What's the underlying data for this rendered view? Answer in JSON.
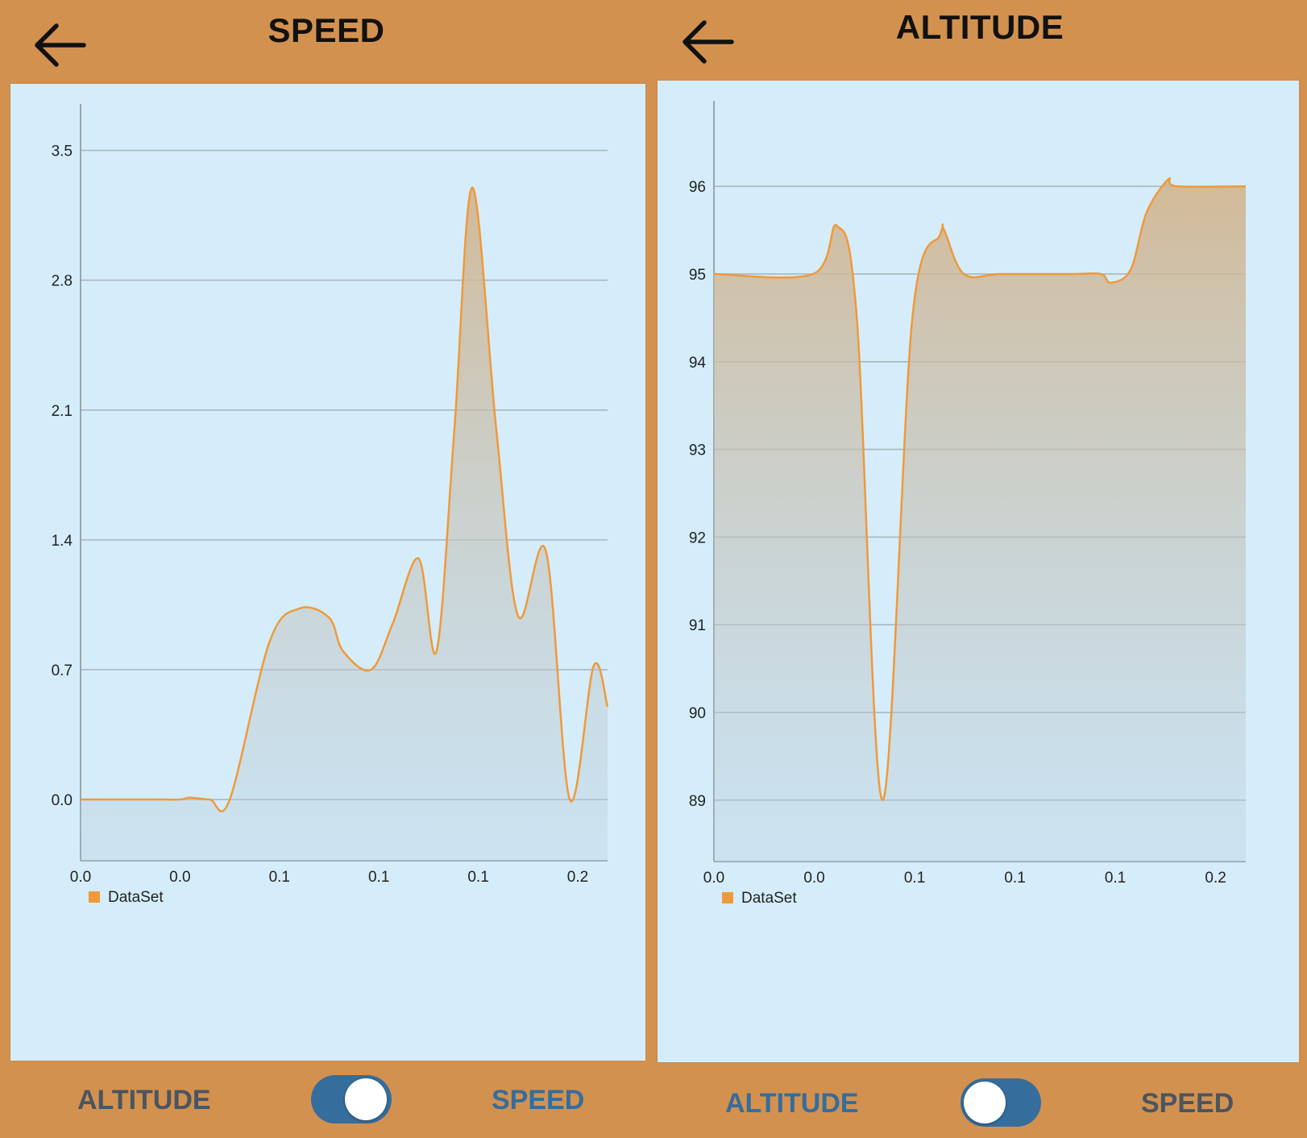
{
  "speed_screen": {
    "title": "SPEED",
    "toggle": {
      "left_label": "ALTITUDE",
      "right_label": "SPEED",
      "state": "on",
      "active_label": "right"
    }
  },
  "altitude_screen": {
    "title": "ALTITUDE",
    "toggle": {
      "left_label": "ALTITUDE",
      "right_label": "SPEED",
      "state": "off",
      "active_label": "left"
    }
  },
  "colors": {
    "background": "#d3914f",
    "chart_panel": "#d5edfa",
    "series_line": "#f0993a",
    "active_label": "#356d9c",
    "inactive_label": "#4a5560",
    "switch_track": "#356d9c"
  },
  "chart_data": [
    {
      "type": "area",
      "legend": [
        "DataSet"
      ],
      "legend_position": "bottom-left",
      "grid": true,
      "x_tick_labels": [
        "0.0",
        "0.0",
        "0.1",
        "0.1",
        "0.1",
        "0.2"
      ],
      "y_ticks": [
        0.0,
        0.7,
        1.4,
        2.1,
        2.8,
        3.5
      ],
      "y_tick_labels": [
        "0.0",
        "0.7",
        "1.4",
        "2.1",
        "2.8",
        "3.5"
      ],
      "ylim": [
        -0.33,
        3.62
      ],
      "xlim": [
        0,
        0.265
      ],
      "series": [
        {
          "name": "DataSet",
          "x": [
            0,
            0.04,
            0.05,
            0.055,
            0.065,
            0.075,
            0.095,
            0.11,
            0.125,
            0.132,
            0.146,
            0.157,
            0.17,
            0.179,
            0.188,
            0.197,
            0.209,
            0.22,
            0.234,
            0.246,
            0.258,
            0.265
          ],
          "y": [
            0,
            0,
            0,
            0.01,
            0,
            0,
            0.85,
            1.03,
            0.98,
            0.8,
            0.7,
            0.95,
            1.3,
            0.8,
            2.0,
            3.3,
            2.0,
            0.99,
            1.34,
            0,
            0.72,
            0.5
          ]
        }
      ]
    },
    {
      "type": "area",
      "legend": [
        "DataSet"
      ],
      "legend_position": "bottom-left",
      "grid": true,
      "x_tick_labels": [
        "0.0",
        "0.0",
        "0.1",
        "0.1",
        "0.1",
        "0.2"
      ],
      "y_ticks": [
        89,
        90,
        91,
        92,
        93,
        94,
        95,
        96
      ],
      "y_tick_labels": [
        "89",
        "90",
        "91",
        "92",
        "93",
        "94",
        "95",
        "96"
      ],
      "ylim": [
        88.3,
        96.7
      ],
      "xlim": [
        0,
        0.268
      ],
      "series": [
        {
          "name": "DataSet",
          "x": [
            0,
            0.05,
            0.062,
            0.072,
            0.085,
            0.1,
            0.114,
            0.116,
            0.126,
            0.145,
            0.18,
            0.195,
            0.2,
            0.21,
            0.218,
            0.229,
            0.233,
            0.268
          ],
          "y": [
            95,
            95,
            95.55,
            94.5,
            89.0,
            94.5,
            95.45,
            95.5,
            95.0,
            95.0,
            95.0,
            95.0,
            94.9,
            95.05,
            95.7,
            96.08,
            96.0,
            96.0
          ]
        }
      ]
    }
  ]
}
